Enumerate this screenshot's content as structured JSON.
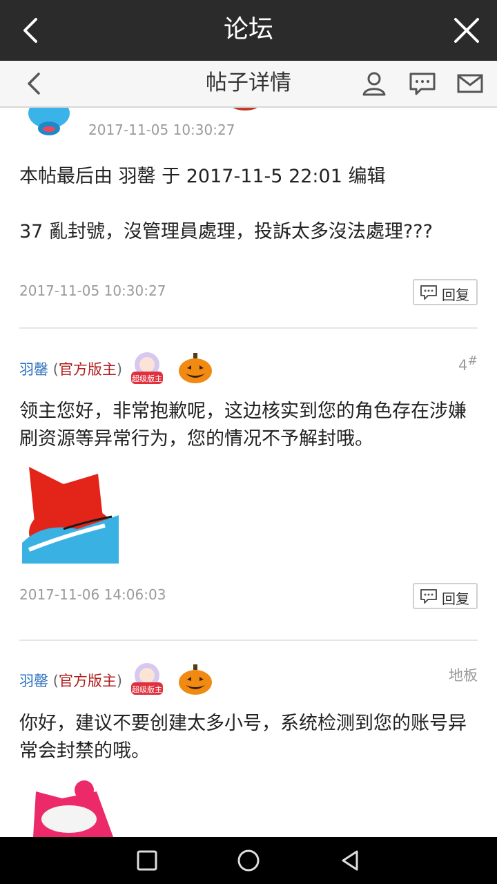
{
  "topbar": {
    "title": "论坛"
  },
  "subbar": {
    "title": "帖子详情"
  },
  "post_top": {
    "time_header": "2017-11-05 10:30:27",
    "edit_note": "本帖最后由 羽罄 于 2017-11-5 22:01 编辑",
    "body": "37 亂封號，沒管理員處理，投訴太多沒法處理???",
    "time": "2017-11-05 10:30:27",
    "reply_label": "回复"
  },
  "reply1": {
    "author_name": "羽罄",
    "author_role": "官方版主",
    "badge_text": "超级版主",
    "floor": "4",
    "floor_sup": "#",
    "body": "领主您好，非常抱歉呢，这边核实到您的角色存在涉嫌刷资源等异常行为，您的情况不予解封哦。",
    "time": "2017-11-06 14:06:03",
    "reply_label": "回复"
  },
  "reply2": {
    "author_name": "羽罄",
    "author_role": "官方版主",
    "badge_text": "超级版主",
    "floor": "地板",
    "body": "你好，建议不要创建太多小号，系统检测到您的账号异常会封禁的哦。"
  },
  "colors": {
    "topbar": "#2b2b2b",
    "link": "#2a6fbf",
    "role": "#b01c1c"
  }
}
